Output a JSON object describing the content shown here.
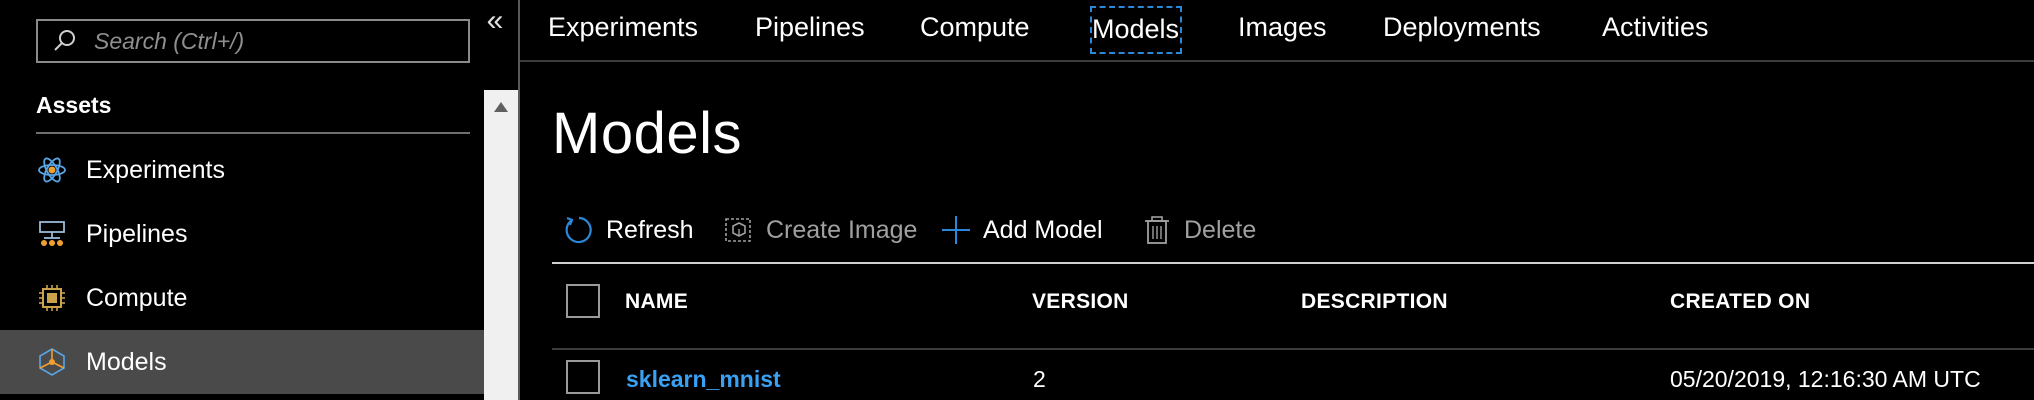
{
  "sidebar": {
    "search_placeholder": "Search (Ctrl+/)",
    "collapse_glyph": "«",
    "section_title": "Assets",
    "items": [
      {
        "label": "Experiments",
        "icon": "experiments-icon"
      },
      {
        "label": "Pipelines",
        "icon": "pipelines-icon"
      },
      {
        "label": "Compute",
        "icon": "compute-icon"
      },
      {
        "label": "Models",
        "icon": "models-icon",
        "selected": true
      }
    ]
  },
  "tabs": [
    {
      "label": "Experiments"
    },
    {
      "label": "Pipelines"
    },
    {
      "label": "Compute"
    },
    {
      "label": "Models",
      "active": true
    },
    {
      "label": "Images"
    },
    {
      "label": "Deployments"
    },
    {
      "label": "Activities"
    }
  ],
  "page": {
    "title": "Models"
  },
  "toolbar": {
    "refresh": "Refresh",
    "create_image": "Create Image",
    "add_model": "Add Model",
    "delete": "Delete"
  },
  "table": {
    "columns": [
      "NAME",
      "VERSION",
      "DESCRIPTION",
      "CREATED ON"
    ],
    "rows": [
      {
        "name": "sklearn_mnist",
        "version": "2",
        "description": "",
        "created_on": "05/20/2019, 12:16:30 AM UTC"
      }
    ]
  },
  "colors": {
    "accent": "#2b88d8",
    "link": "#3aa0f3",
    "selected_bg": "#4a4a4a",
    "background": "#000000"
  }
}
